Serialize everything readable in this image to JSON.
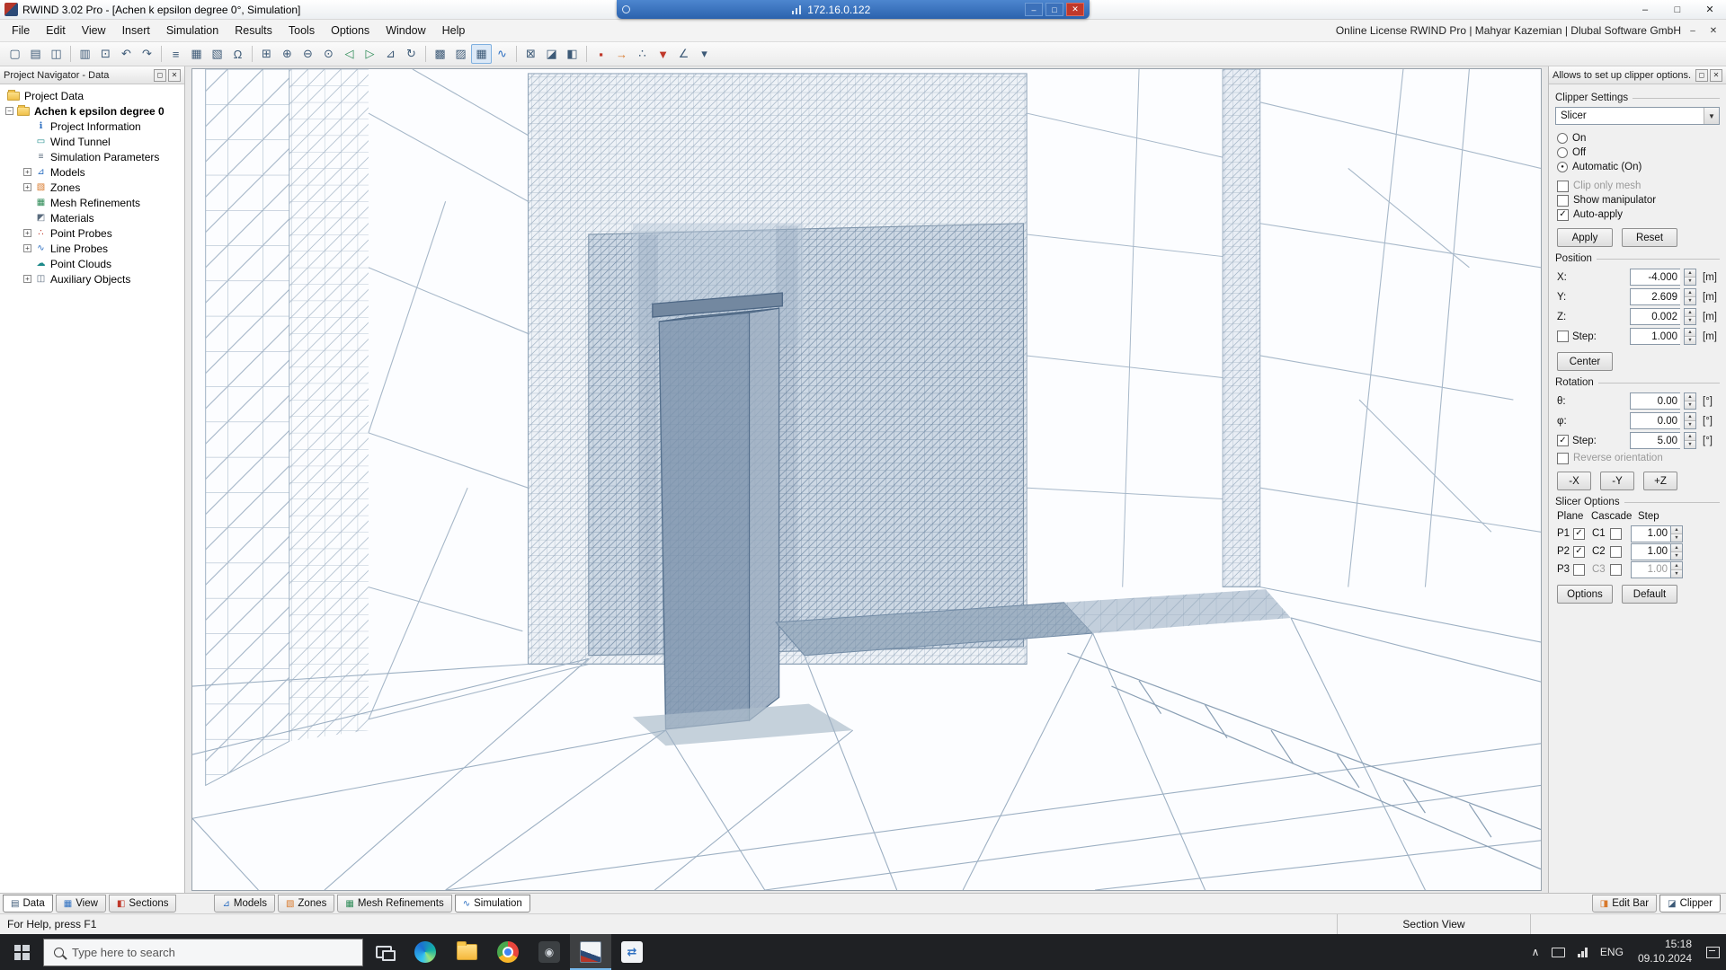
{
  "window": {
    "title": "RWIND 3.02 Pro - [Achen  k epsilon degree 0°, Simulation]",
    "license": "Online License RWIND Pro | Mahyar Kazemian | Dlubal Software GmbH",
    "remote": {
      "ip": "172.16.0.122"
    },
    "buttons": {
      "minimize": "–",
      "restore": "□",
      "close": "✕"
    }
  },
  "menu": {
    "items": [
      {
        "name": "menu-file",
        "label": "File"
      },
      {
        "name": "menu-edit",
        "label": "Edit"
      },
      {
        "name": "menu-view",
        "label": "View"
      },
      {
        "name": "menu-insert",
        "label": "Insert"
      },
      {
        "name": "menu-simulation",
        "label": "Simulation"
      },
      {
        "name": "menu-results",
        "label": "Results"
      },
      {
        "name": "menu-tools",
        "label": "Tools"
      },
      {
        "name": "menu-options",
        "label": "Options"
      },
      {
        "name": "menu-window",
        "label": "Window"
      },
      {
        "name": "menu-help",
        "label": "Help"
      }
    ]
  },
  "toolbar": {
    "icons": [
      {
        "name": "new-file-icon",
        "glyph": "▢",
        "cls": "tbi"
      },
      {
        "name": "open-file-icon",
        "glyph": "▤",
        "cls": "tbi"
      },
      {
        "name": "save-icon",
        "glyph": "◫",
        "cls": "tbi"
      },
      {
        "name": "separator",
        "glyph": "",
        "cls": "tbsep"
      },
      {
        "name": "print-icon",
        "glyph": "▥",
        "cls": "tbi"
      },
      {
        "name": "copy-icon",
        "glyph": "⊡",
        "cls": "tbi"
      },
      {
        "name": "undo-icon",
        "glyph": "↶",
        "cls": "tbi"
      },
      {
        "name": "redo-icon",
        "glyph": "↷",
        "cls": "tbi"
      },
      {
        "name": "separator",
        "glyph": "",
        "cls": "tbsep"
      },
      {
        "name": "project-navigator-icon",
        "glyph": "≡",
        "cls": "tbi"
      },
      {
        "name": "tables-icon",
        "glyph": "▦",
        "cls": "tbi"
      },
      {
        "name": "display-properties-icon",
        "glyph": "▧",
        "cls": "tbi"
      },
      {
        "name": "units-icon",
        "glyph": "Ω",
        "cls": "tbi"
      },
      {
        "name": "separator",
        "glyph": "",
        "cls": "tbsep"
      },
      {
        "name": "zoom-window-icon",
        "glyph": "⊞",
        "cls": "tbi"
      },
      {
        "name": "zoom-in-icon",
        "glyph": "⊕",
        "cls": "tbi"
      },
      {
        "name": "zoom-out-icon",
        "glyph": "⊖",
        "cls": "tbi"
      },
      {
        "name": "zoom-all-icon",
        "glyph": "⊙",
        "cls": "tbi"
      },
      {
        "name": "previous-view-icon",
        "glyph": "◁",
        "cls": "tbi green"
      },
      {
        "name": "next-view-icon",
        "glyph": "▷",
        "cls": "tbi green"
      },
      {
        "name": "isometric-view-icon",
        "glyph": "⊿",
        "cls": "tbi"
      },
      {
        "name": "rotate-view-icon",
        "glyph": "↻",
        "cls": "tbi"
      },
      {
        "name": "separator",
        "glyph": "",
        "cls": "tbsep"
      },
      {
        "name": "wireframe-mode-icon",
        "glyph": "▩",
        "cls": "tbi"
      },
      {
        "name": "solid-mode-icon",
        "glyph": "▨",
        "cls": "tbi"
      },
      {
        "name": "mesh-view-icon",
        "glyph": "▦",
        "cls": "tbi active"
      },
      {
        "name": "streamlines-icon",
        "glyph": "∿",
        "cls": "tbi blue"
      },
      {
        "name": "separator",
        "glyph": "",
        "cls": "tbsep"
      },
      {
        "name": "clipping-box-icon",
        "glyph": "⊠",
        "cls": "tbi"
      },
      {
        "name": "slicer-plane-icon",
        "glyph": "◪",
        "cls": "tbi"
      },
      {
        "name": "section-plane-icon",
        "glyph": "◧",
        "cls": "tbi"
      },
      {
        "name": "separator",
        "glyph": "",
        "cls": "tbsep"
      },
      {
        "name": "stop-simulation-icon",
        "glyph": "▪",
        "cls": "tbi red"
      },
      {
        "name": "wind-direction-icon",
        "glyph": "→",
        "cls": "tbi orange"
      },
      {
        "name": "probe-icon",
        "glyph": "∴",
        "cls": "tbi"
      },
      {
        "name": "result-filter-icon",
        "glyph": "▼",
        "cls": "tbi red"
      },
      {
        "name": "measure-icon",
        "glyph": "∠",
        "cls": "tbi"
      },
      {
        "name": "options-dropdown-icon",
        "glyph": "▾",
        "cls": "tbi"
      }
    ]
  },
  "navigator": {
    "title": "Project Navigator - Data",
    "root_label": "Project Data",
    "project_exp": "−",
    "project_label": "Achen  k epsilon degree 0",
    "items": [
      {
        "name": "nav-project-information",
        "label": "Project Information",
        "exp": "",
        "icon": "ℹ",
        "icls": "ticon c-blue"
      },
      {
        "name": "nav-wind-tunnel",
        "label": "Wind Tunnel",
        "exp": "",
        "icon": "▭",
        "icls": "ticon c-teal"
      },
      {
        "name": "nav-simulation-parameters",
        "label": "Simulation Parameters",
        "exp": "",
        "icon": "≡",
        "icls": "ticon c-gray"
      },
      {
        "name": "nav-models",
        "label": "Models",
        "exp": "+",
        "icon": "⊿",
        "icls": "ticon c-blue"
      },
      {
        "name": "nav-zones",
        "label": "Zones",
        "exp": "+",
        "icon": "▧",
        "icls": "ticon c-orange"
      },
      {
        "name": "nav-mesh-refinements",
        "label": "Mesh Refinements",
        "exp": "",
        "icon": "▦",
        "icls": "ticon c-green"
      },
      {
        "name": "nav-materials",
        "label": "Materials",
        "exp": "",
        "icon": "◩",
        "icls": "ticon c-gray"
      },
      {
        "name": "nav-point-probes",
        "label": "Point Probes",
        "exp": "+",
        "icon": "∴",
        "icls": "ticon c-red"
      },
      {
        "name": "nav-line-probes",
        "label": "Line Probes",
        "exp": "+",
        "icon": "∿",
        "icls": "ticon c-blue"
      },
      {
        "name": "nav-point-clouds",
        "label": "Point Clouds",
        "exp": "",
        "icon": "☁",
        "icls": "ticon c-teal"
      },
      {
        "name": "nav-auxiliary-objects",
        "label": "Auxiliary Objects",
        "exp": "+",
        "icon": "◫",
        "icls": "ticon c-gray"
      }
    ]
  },
  "clipper": {
    "panel_title": "Allows to set up clipper options.",
    "groups": {
      "settings": "Clipper Settings",
      "position": "Position",
      "rotation": "Rotation",
      "slicer": "Slicer Options"
    },
    "slicer_type": "Slicer",
    "radios": [
      {
        "name": "radio-on",
        "label": "On",
        "dot": ""
      },
      {
        "name": "radio-off",
        "label": "Off",
        "dot": ""
      },
      {
        "name": "radio-automatic-on",
        "label": "Automatic (On)",
        "dot": "●"
      }
    ],
    "checks": [
      {
        "name": "check-clip-only-mesh",
        "label": "Clip only mesh",
        "mark": "",
        "lcls": "lab dis"
      },
      {
        "name": "check-show-manipulator",
        "label": "Show manipulator",
        "mark": "",
        "lcls": "lab"
      },
      {
        "name": "check-auto-apply",
        "label": "Auto-apply",
        "mark": "✓",
        "lcls": "lab"
      }
    ],
    "apply_label": "Apply",
    "reset_label": "Reset",
    "position": {
      "x_label": "X:",
      "x": "-4.000",
      "y_label": "Y:",
      "y": "2.609",
      "z_label": "Z:",
      "z": "0.002",
      "step_label": "Step:",
      "step": "1.000",
      "step_mark": "",
      "unit": "[m]",
      "center_label": "Center"
    },
    "rotation": {
      "theta_label": "θ:",
      "theta": "0.00",
      "phi_label": "φ:",
      "phi": "0.00",
      "step_label": "Step:",
      "step": "5.00",
      "step_mark": "✓",
      "unit": "[°]",
      "reverse_label": "Reverse orientation",
      "reverse_mark": "",
      "minus_x": "-X",
      "minus_y": "-Y",
      "plus_z": "+Z"
    },
    "slicer_options": {
      "col_plane": "Plane",
      "col_cascade": "Cascade",
      "col_step": "Step",
      "rows": [
        {
          "name": "slicer-row-p1",
          "plane": "P1",
          "pmark": "✓",
          "cascade": "C1",
          "cmark": "",
          "ccls": "clab",
          "step": "1.00",
          "ncls": "num"
        },
        {
          "name": "slicer-row-p2",
          "plane": "P2",
          "pmark": "✓",
          "cascade": "C2",
          "cmark": "",
          "ccls": "clab",
          "step": "1.00",
          "ncls": "num"
        },
        {
          "name": "slicer-row-p3",
          "plane": "P3",
          "pmark": "",
          "cascade": "C3",
          "cmark": "",
          "ccls": "clab dis",
          "step": "1.00",
          "ncls": "num dis"
        }
      ],
      "options_label": "Options",
      "default_label": "Default"
    }
  },
  "tabs": {
    "left": [
      {
        "name": "tab-data",
        "label": "Data",
        "icon": "▤",
        "icls": "ti c-nav",
        "cls": "btab active"
      },
      {
        "name": "tab-view",
        "label": "View",
        "icon": "▦",
        "icls": "ti c-blue",
        "cls": "btab"
      },
      {
        "name": "tab-sections",
        "label": "Sections",
        "icon": "◧",
        "icls": "ti c-red",
        "cls": "btab"
      }
    ],
    "mid": [
      {
        "name": "tab-models",
        "label": "Models",
        "icon": "⊿",
        "icls": "ti c-blue",
        "cls": "btab"
      },
      {
        "name": "tab-zones",
        "label": "Zones",
        "icon": "▧",
        "icls": "ti c-orange",
        "cls": "btab"
      },
      {
        "name": "tab-mesh-refinements",
        "label": "Mesh Refinements",
        "icon": "▦",
        "icls": "ti c-green",
        "cls": "btab"
      },
      {
        "name": "tab-simulation",
        "label": "Simulation",
        "icon": "∿",
        "icls": "ti c-blue",
        "cls": "btab active"
      }
    ],
    "right": [
      {
        "name": "tab-edit-bar",
        "label": "Edit Bar",
        "icon": "◨",
        "icls": "ti c-orange",
        "cls": "btab"
      },
      {
        "name": "tab-clipper",
        "label": "Clipper",
        "icon": "◪",
        "icls": "ti c-nav",
        "cls": "btab active"
      }
    ]
  },
  "statusbar": {
    "help": "For Help, press F1",
    "view_label": "Section View"
  },
  "taskbar": {
    "search_placeholder": "Type here to search",
    "apps": [
      {
        "name": "task-view-button",
        "cls": "tapp",
        "icn": "tv",
        "glyph": ""
      },
      {
        "name": "taskbar-edge",
        "cls": "tapp",
        "icn": "edge",
        "glyph": ""
      },
      {
        "name": "taskbar-file-explorer",
        "cls": "tapp",
        "icn": "fexp",
        "glyph": ""
      },
      {
        "name": "taskbar-chrome",
        "cls": "tapp",
        "icn": "chrome",
        "glyph": ""
      },
      {
        "name": "taskbar-capture-app",
        "cls": "tapp",
        "icn": "cap",
        "glyph": "◉"
      },
      {
        "name": "taskbar-rwind",
        "cls": "tapp active",
        "icn": "rwind",
        "glyph": ""
      },
      {
        "name": "taskbar-converter-app",
        "cls": "tapp",
        "icn": "conv",
        "glyph": "⇄"
      }
    ],
    "lang": "ENG",
    "time": "15:18",
    "date": "09.10.2024"
  }
}
